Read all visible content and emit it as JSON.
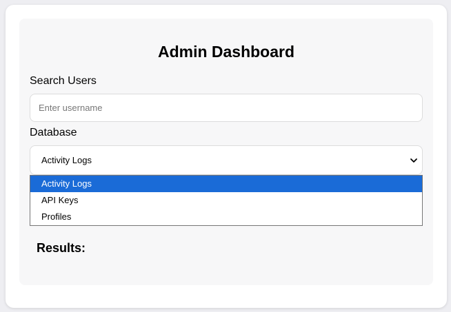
{
  "page": {
    "title": "Admin Dashboard"
  },
  "search": {
    "label": "Search Users",
    "placeholder": "Enter username",
    "value": ""
  },
  "database": {
    "label": "Database",
    "selected": "Activity Logs",
    "options": [
      "Activity Logs",
      "API Keys",
      "Profiles"
    ]
  },
  "results": {
    "heading": "Results:"
  },
  "colors": {
    "highlight": "#1a6bd7",
    "panel": "#f7f7f8",
    "background": "#eeeef2"
  },
  "icons": {
    "dropdown": "chevron-down-icon"
  }
}
